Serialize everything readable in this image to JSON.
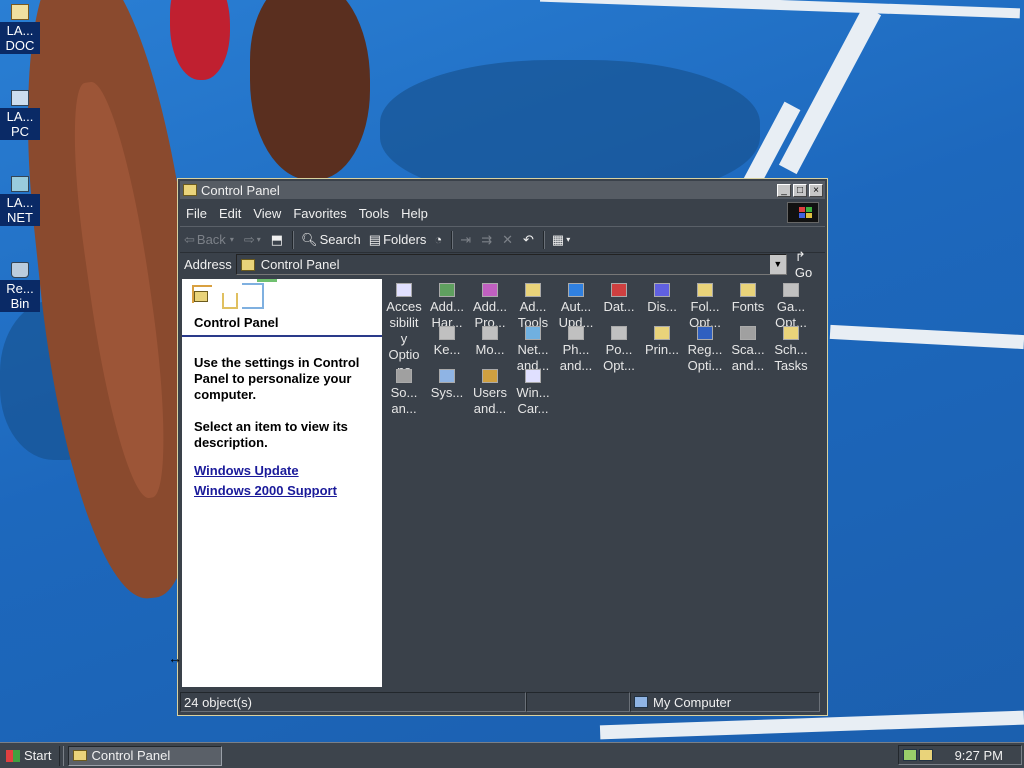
{
  "desktop": {
    "icons": [
      {
        "label": "LA... DOC",
        "line1": "LA...",
        "line2": "DOC",
        "icon": "home-folder-icon"
      },
      {
        "label": "LA... PC",
        "line1": "LA...",
        "line2": "PC",
        "icon": "my-computer-icon"
      },
      {
        "label": "LA... NET",
        "line1": "LA...",
        "line2": "NET",
        "icon": "network-places-icon"
      },
      {
        "label": "Re... Bin",
        "line1": "Re...",
        "line2": "Bin",
        "icon": "recycle-bin-icon"
      }
    ]
  },
  "window": {
    "title": "Control Panel",
    "buttons": {
      "minimize": "_",
      "maximize": "□",
      "close": "×"
    },
    "menu": [
      "File",
      "Edit",
      "View",
      "Favorites",
      "Tools",
      "Help"
    ],
    "toolbar": {
      "back": "Back",
      "search": "Search",
      "folders": "Folders"
    },
    "address": {
      "label": "Address",
      "value": "Control Panel",
      "go": "Go"
    },
    "left_pane": {
      "title": "Control Panel",
      "description": "Use the settings in Control Panel to personalize your computer.",
      "hint": "Select an item to view its description.",
      "links": [
        "Windows Update",
        "Windows 2000 Support"
      ]
    },
    "items": [
      {
        "l1": "Acces",
        "l2": "sibilit",
        "l3": "y",
        "l4": "Optio",
        "l5": "ns",
        "icon": "accessibility-icon",
        "color": "#e0e0ff"
      },
      {
        "l1": "Add...",
        "l2": "Har...",
        "icon": "add-hardware-icon",
        "color": "#5fa05f"
      },
      {
        "l1": "Add...",
        "l2": "Pro...",
        "icon": "add-remove-programs-icon",
        "color": "#c060c0"
      },
      {
        "l1": "Ad...",
        "l2": "Tools",
        "icon": "admin-tools-icon",
        "color": "#e9d37a"
      },
      {
        "l1": "Aut...",
        "l2": "Upd...",
        "icon": "automatic-updates-icon",
        "color": "#3080e0"
      },
      {
        "l1": "Dat...",
        "icon": "date-time-icon",
        "color": "#d04040"
      },
      {
        "l1": "Dis...",
        "icon": "display-icon",
        "color": "#6060e0"
      },
      {
        "l1": "Fol...",
        "l2": "Opt...",
        "icon": "folder-options-icon",
        "color": "#e9d37a"
      },
      {
        "l1": "Fonts",
        "icon": "fonts-icon",
        "color": "#e9d37a"
      },
      {
        "l1": "Ga...",
        "l2": "Opt...",
        "icon": "game-controllers-icon",
        "color": "#c0c0c0"
      },
      {
        "l1": "Ke...",
        "icon": "keyboard-icon",
        "color": "#c0c0c0"
      },
      {
        "l1": "Mo...",
        "icon": "mouse-icon",
        "color": "#c0c0c0"
      },
      {
        "l1": "Net...",
        "l2": "and...",
        "icon": "network-connections-icon",
        "color": "#70b0e0"
      },
      {
        "l1": "Ph...",
        "l2": "and...",
        "icon": "phone-modem-icon",
        "color": "#c0c0c0"
      },
      {
        "l1": "Po...",
        "l2": "Opt...",
        "icon": "power-options-icon",
        "color": "#c0c0c0"
      },
      {
        "l1": "Prin...",
        "icon": "printers-icon",
        "color": "#e9d37a"
      },
      {
        "l1": "Reg...",
        "l2": "Opti...",
        "icon": "regional-options-icon",
        "color": "#3060c0"
      },
      {
        "l1": "Sca...",
        "l2": "and...",
        "icon": "scanners-cameras-icon",
        "color": "#a0a0a0"
      },
      {
        "l1": "Sch...",
        "l2": "Tasks",
        "icon": "scheduled-tasks-icon",
        "color": "#e9d37a"
      },
      {
        "l1": "So...",
        "l2": "an...",
        "icon": "sounds-multimedia-icon",
        "color": "#a0a0a0"
      },
      {
        "l1": "Sys...",
        "icon": "system-icon",
        "color": "#8fb4e4"
      },
      {
        "l1": "Users",
        "l2": "and...",
        "icon": "users-passwords-icon",
        "color": "#d0a040"
      },
      {
        "l1": "Win...",
        "l2": "Car...",
        "icon": "wireless-icon",
        "color": "#e0e0ff"
      }
    ],
    "status": {
      "objects": "24 object(s)",
      "zone": "My Computer"
    }
  },
  "taskbar": {
    "start": "Start",
    "task": "Control Panel",
    "clock": "9:27 PM"
  },
  "colors": {
    "window_bg": "#3a414a",
    "titlebar": "#565c64",
    "link": "#1a1a9a"
  }
}
